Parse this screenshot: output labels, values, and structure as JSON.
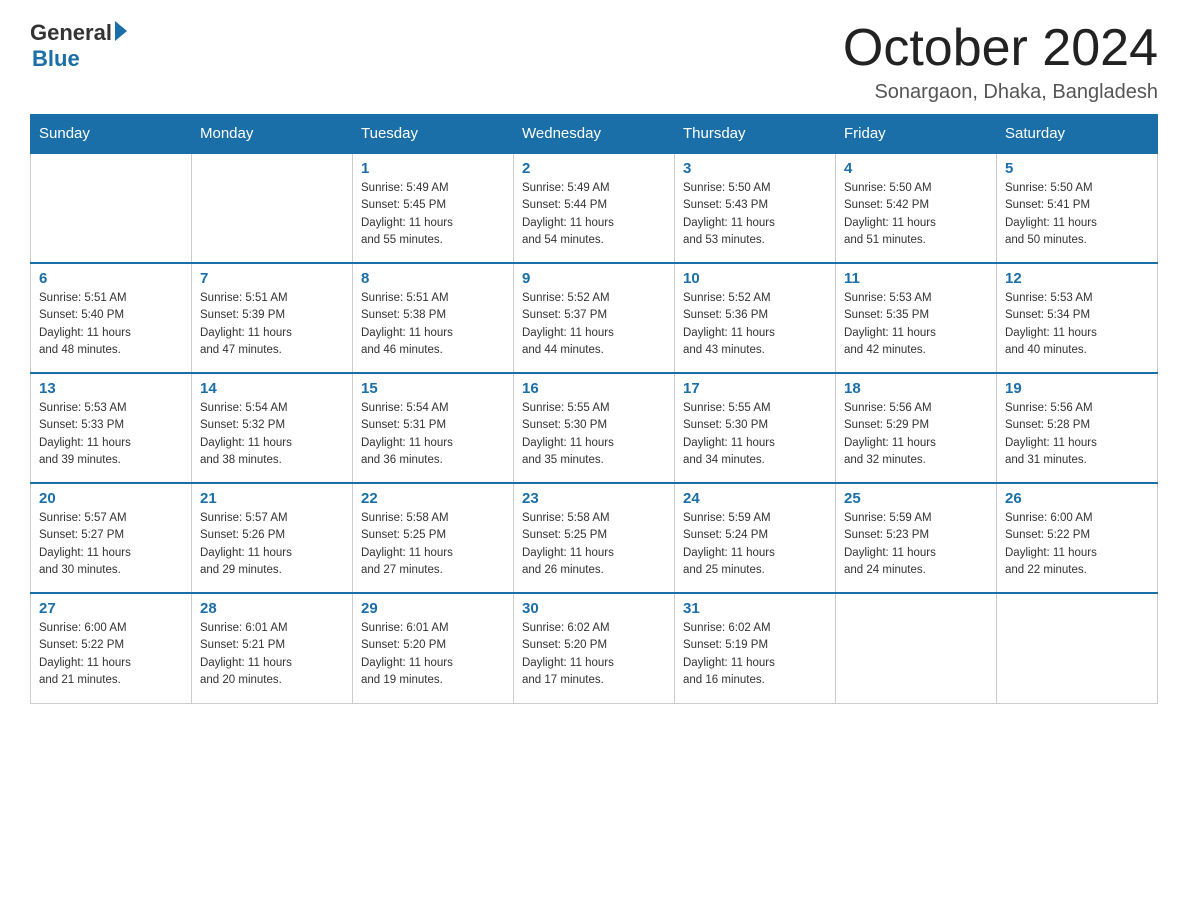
{
  "logo": {
    "general": "General",
    "blue": "Blue"
  },
  "title": "October 2024",
  "location": "Sonargaon, Dhaka, Bangladesh",
  "weekdays": [
    "Sunday",
    "Monday",
    "Tuesday",
    "Wednesday",
    "Thursday",
    "Friday",
    "Saturday"
  ],
  "weeks": [
    [
      {
        "day": "",
        "info": ""
      },
      {
        "day": "",
        "info": ""
      },
      {
        "day": "1",
        "info": "Sunrise: 5:49 AM\nSunset: 5:45 PM\nDaylight: 11 hours\nand 55 minutes."
      },
      {
        "day": "2",
        "info": "Sunrise: 5:49 AM\nSunset: 5:44 PM\nDaylight: 11 hours\nand 54 minutes."
      },
      {
        "day": "3",
        "info": "Sunrise: 5:50 AM\nSunset: 5:43 PM\nDaylight: 11 hours\nand 53 minutes."
      },
      {
        "day": "4",
        "info": "Sunrise: 5:50 AM\nSunset: 5:42 PM\nDaylight: 11 hours\nand 51 minutes."
      },
      {
        "day": "5",
        "info": "Sunrise: 5:50 AM\nSunset: 5:41 PM\nDaylight: 11 hours\nand 50 minutes."
      }
    ],
    [
      {
        "day": "6",
        "info": "Sunrise: 5:51 AM\nSunset: 5:40 PM\nDaylight: 11 hours\nand 48 minutes."
      },
      {
        "day": "7",
        "info": "Sunrise: 5:51 AM\nSunset: 5:39 PM\nDaylight: 11 hours\nand 47 minutes."
      },
      {
        "day": "8",
        "info": "Sunrise: 5:51 AM\nSunset: 5:38 PM\nDaylight: 11 hours\nand 46 minutes."
      },
      {
        "day": "9",
        "info": "Sunrise: 5:52 AM\nSunset: 5:37 PM\nDaylight: 11 hours\nand 44 minutes."
      },
      {
        "day": "10",
        "info": "Sunrise: 5:52 AM\nSunset: 5:36 PM\nDaylight: 11 hours\nand 43 minutes."
      },
      {
        "day": "11",
        "info": "Sunrise: 5:53 AM\nSunset: 5:35 PM\nDaylight: 11 hours\nand 42 minutes."
      },
      {
        "day": "12",
        "info": "Sunrise: 5:53 AM\nSunset: 5:34 PM\nDaylight: 11 hours\nand 40 minutes."
      }
    ],
    [
      {
        "day": "13",
        "info": "Sunrise: 5:53 AM\nSunset: 5:33 PM\nDaylight: 11 hours\nand 39 minutes."
      },
      {
        "day": "14",
        "info": "Sunrise: 5:54 AM\nSunset: 5:32 PM\nDaylight: 11 hours\nand 38 minutes."
      },
      {
        "day": "15",
        "info": "Sunrise: 5:54 AM\nSunset: 5:31 PM\nDaylight: 11 hours\nand 36 minutes."
      },
      {
        "day": "16",
        "info": "Sunrise: 5:55 AM\nSunset: 5:30 PM\nDaylight: 11 hours\nand 35 minutes."
      },
      {
        "day": "17",
        "info": "Sunrise: 5:55 AM\nSunset: 5:30 PM\nDaylight: 11 hours\nand 34 minutes."
      },
      {
        "day": "18",
        "info": "Sunrise: 5:56 AM\nSunset: 5:29 PM\nDaylight: 11 hours\nand 32 minutes."
      },
      {
        "day": "19",
        "info": "Sunrise: 5:56 AM\nSunset: 5:28 PM\nDaylight: 11 hours\nand 31 minutes."
      }
    ],
    [
      {
        "day": "20",
        "info": "Sunrise: 5:57 AM\nSunset: 5:27 PM\nDaylight: 11 hours\nand 30 minutes."
      },
      {
        "day": "21",
        "info": "Sunrise: 5:57 AM\nSunset: 5:26 PM\nDaylight: 11 hours\nand 29 minutes."
      },
      {
        "day": "22",
        "info": "Sunrise: 5:58 AM\nSunset: 5:25 PM\nDaylight: 11 hours\nand 27 minutes."
      },
      {
        "day": "23",
        "info": "Sunrise: 5:58 AM\nSunset: 5:25 PM\nDaylight: 11 hours\nand 26 minutes."
      },
      {
        "day": "24",
        "info": "Sunrise: 5:59 AM\nSunset: 5:24 PM\nDaylight: 11 hours\nand 25 minutes."
      },
      {
        "day": "25",
        "info": "Sunrise: 5:59 AM\nSunset: 5:23 PM\nDaylight: 11 hours\nand 24 minutes."
      },
      {
        "day": "26",
        "info": "Sunrise: 6:00 AM\nSunset: 5:22 PM\nDaylight: 11 hours\nand 22 minutes."
      }
    ],
    [
      {
        "day": "27",
        "info": "Sunrise: 6:00 AM\nSunset: 5:22 PM\nDaylight: 11 hours\nand 21 minutes."
      },
      {
        "day": "28",
        "info": "Sunrise: 6:01 AM\nSunset: 5:21 PM\nDaylight: 11 hours\nand 20 minutes."
      },
      {
        "day": "29",
        "info": "Sunrise: 6:01 AM\nSunset: 5:20 PM\nDaylight: 11 hours\nand 19 minutes."
      },
      {
        "day": "30",
        "info": "Sunrise: 6:02 AM\nSunset: 5:20 PM\nDaylight: 11 hours\nand 17 minutes."
      },
      {
        "day": "31",
        "info": "Sunrise: 6:02 AM\nSunset: 5:19 PM\nDaylight: 11 hours\nand 16 minutes."
      },
      {
        "day": "",
        "info": ""
      },
      {
        "day": "",
        "info": ""
      }
    ]
  ]
}
